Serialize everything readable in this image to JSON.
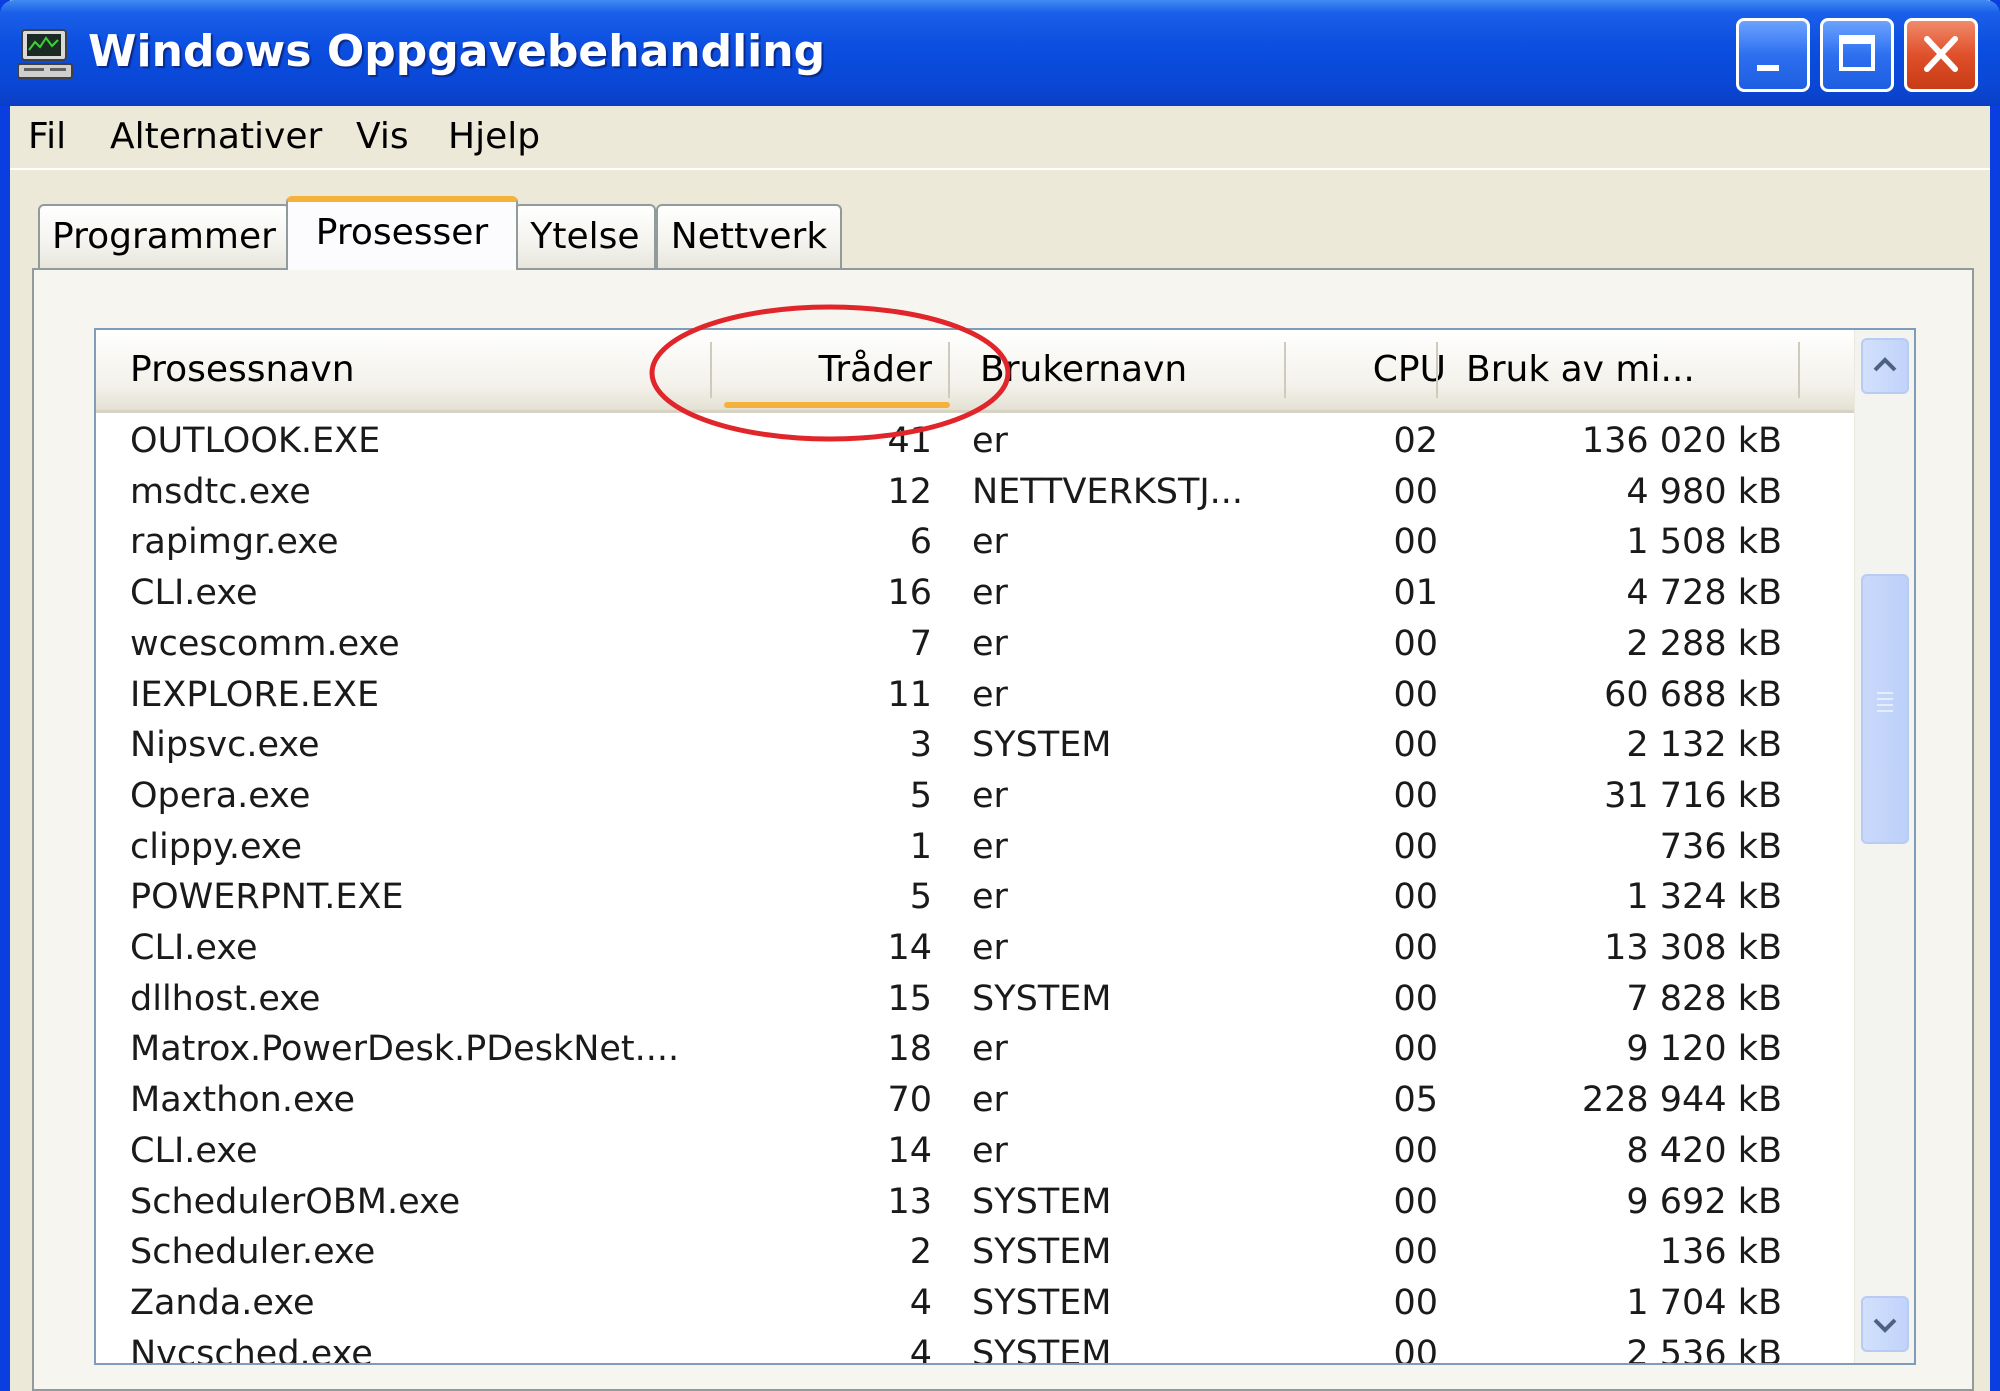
{
  "window": {
    "title": "Windows Oppgavebehandling",
    "icon": "task-manager-computer-icon",
    "controls": [
      "minimize-icon",
      "maximize-icon",
      "close-icon"
    ]
  },
  "menu": [
    {
      "label": "Fil"
    },
    {
      "label": "Alternativer"
    },
    {
      "label": "Vis"
    },
    {
      "label": "Hjelp"
    }
  ],
  "tabs": [
    {
      "label": "Programmer",
      "active": false
    },
    {
      "label": "Prosesser",
      "active": true
    },
    {
      "label": "Ytelse",
      "active": false
    },
    {
      "label": "Nettverk",
      "active": false
    }
  ],
  "table": {
    "columns": [
      {
        "label": "Prosessnavn"
      },
      {
        "label": "Tråder",
        "sorted": true
      },
      {
        "label": "Brukernavn"
      },
      {
        "label": "CPU"
      },
      {
        "label": "Bruk av mi..."
      }
    ],
    "rows": [
      [
        "OUTLOOK.EXE",
        "41",
        "er",
        "02",
        "136 020 kB"
      ],
      [
        "msdtc.exe",
        "12",
        "NETTVERKSTJ...",
        "00",
        "4 980 kB"
      ],
      [
        "rapimgr.exe",
        "6",
        "er",
        "00",
        "1 508 kB"
      ],
      [
        "CLI.exe",
        "16",
        "er",
        "01",
        "4 728 kB"
      ],
      [
        "wcescomm.exe",
        "7",
        "er",
        "00",
        "2 288 kB"
      ],
      [
        "IEXPLORE.EXE",
        "11",
        "er",
        "00",
        "60 688 kB"
      ],
      [
        "Nipsvc.exe",
        "3",
        "SYSTEM",
        "00",
        "2 132 kB"
      ],
      [
        "Opera.exe",
        "5",
        "er",
        "00",
        "31 716 kB"
      ],
      [
        "clippy.exe",
        "1",
        "er",
        "00",
        "736 kB"
      ],
      [
        "POWERPNT.EXE",
        "5",
        "er",
        "00",
        "1 324 kB"
      ],
      [
        "CLI.exe",
        "14",
        "er",
        "00",
        "13 308 kB"
      ],
      [
        "dllhost.exe",
        "15",
        "SYSTEM",
        "00",
        "7 828 kB"
      ],
      [
        "Matrox.PowerDesk.PDeskNet....",
        "18",
        "er",
        "00",
        "9 120 kB"
      ],
      [
        "Maxthon.exe",
        "70",
        "er",
        "05",
        "228 944 kB"
      ],
      [
        "CLI.exe",
        "14",
        "er",
        "00",
        "8 420 kB"
      ],
      [
        "SchedulerOBM.exe",
        "13",
        "SYSTEM",
        "00",
        "9 692 kB"
      ],
      [
        "Scheduler.exe",
        "2",
        "SYSTEM",
        "00",
        "136 kB"
      ],
      [
        "Zanda.exe",
        "4",
        "SYSTEM",
        "00",
        "1 704 kB"
      ],
      [
        "Nvcsched.exe",
        "4",
        "SYSTEM",
        "00",
        "2 536 kB"
      ]
    ]
  },
  "scrollbar": {
    "up_icon": "scroll-up-arrow-icon",
    "down_icon": "scroll-down-arrow-icon"
  },
  "annotation": {
    "shape": "red-ellipse",
    "color": "#e0262b",
    "target": "Tråder"
  },
  "colors": {
    "titlebar": "#0b4ee0",
    "window_bg": "#ece9d8",
    "active_tab_accent": "#f4b23c",
    "close_button": "#e0502a"
  }
}
